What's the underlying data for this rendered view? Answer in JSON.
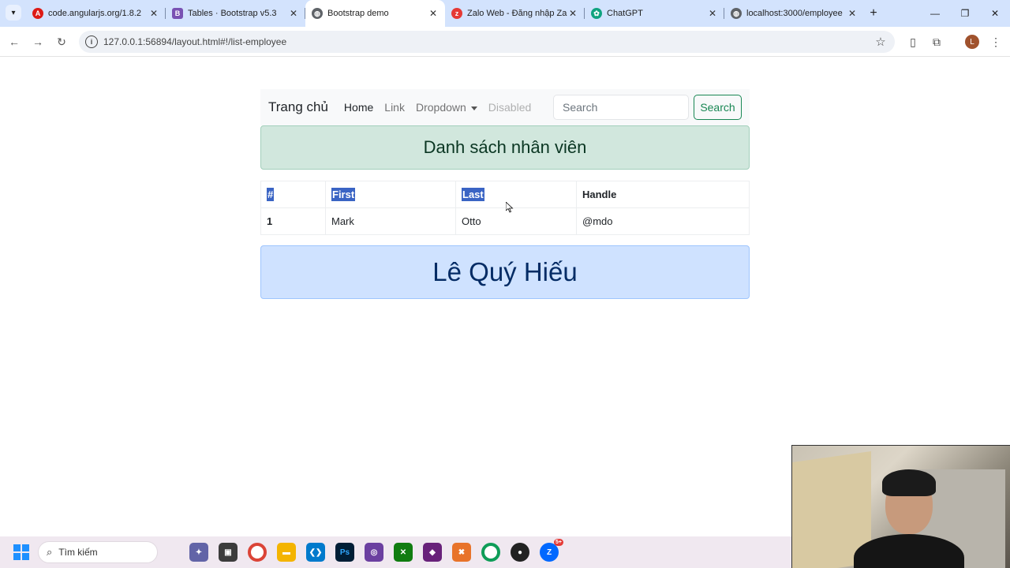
{
  "browser": {
    "tabs": [
      {
        "title": "code.angularjs.org/1.8.2",
        "icon": "angular-icon",
        "color": "#dd1b16",
        "active": false
      },
      {
        "title": "Tables · Bootstrap v5.3",
        "icon": "bootstrap-icon",
        "color": "#7952b3",
        "active": false
      },
      {
        "title": "Bootstrap demo",
        "icon": "globe-icon",
        "color": "#5f6368",
        "active": true
      },
      {
        "title": "Zalo Web - Đăng nhập Zalo",
        "icon": "zalo-icon",
        "color": "#e53935",
        "active": false
      },
      {
        "title": "ChatGPT",
        "icon": "chatgpt-icon",
        "color": "#10a37f",
        "active": false
      },
      {
        "title": "localhost:3000/employee",
        "icon": "globe-icon",
        "color": "#5f6368",
        "active": false
      }
    ],
    "url": "127.0.0.1:56894/layout.html#!/list-employee",
    "profile_initial": "L"
  },
  "navbar": {
    "brand": "Trang chủ",
    "links": {
      "home": "Home",
      "link": "Link",
      "dropdown": "Dropdown",
      "disabled": "Disabled"
    },
    "search_placeholder": "Search",
    "search_button": "Search"
  },
  "heading": "Danh sách nhân viên",
  "table": {
    "headers": {
      "num": "#",
      "first": "First",
      "last": "Last",
      "handle": "Handle"
    },
    "rows": [
      {
        "num": "1",
        "first": "Mark",
        "last": "Otto",
        "handle": "@mdo"
      }
    ]
  },
  "author": "Lê Quý Hiếu",
  "taskbar": {
    "search_label": "Tìm kiếm",
    "zalo_badge": "5+"
  },
  "colors": {
    "success_alert_bg": "#d1e7dd",
    "primary_alert_bg": "#cfe2ff",
    "search_button": "#198754",
    "selection": "#3a64c4"
  }
}
